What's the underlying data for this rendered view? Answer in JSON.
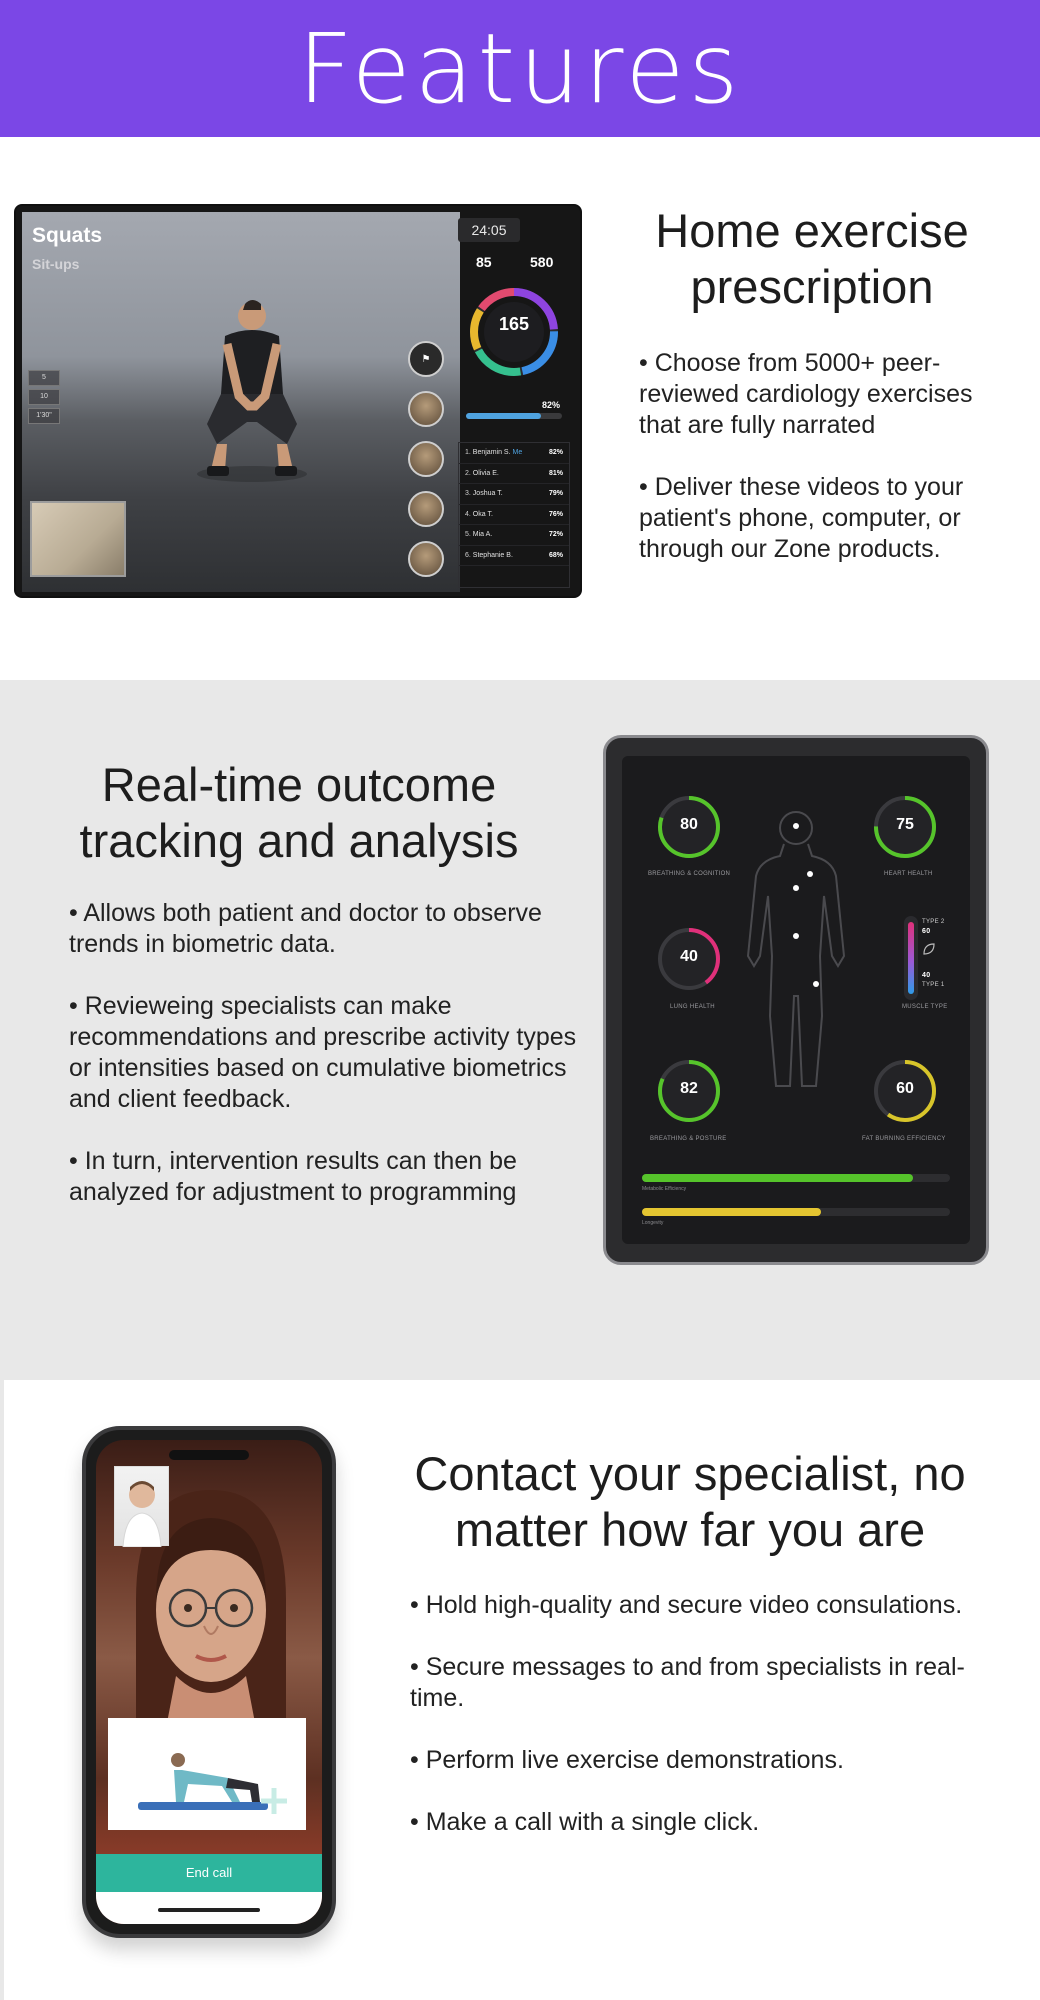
{
  "header": {
    "title": "Features"
  },
  "section1": {
    "title": "Home exercise prescription",
    "bullets": [
      "• Choose from 5000+ peer-reviewed cardiology exercises that are fully narrated",
      "• Deliver these videos to your patient's phone, computer, or through our Zone products."
    ],
    "screen": {
      "exercise_current": "Squats",
      "exercise_next": "Sit-ups",
      "timer": "24:05",
      "stat_left": "85",
      "stat_right": "580",
      "ring_value": "165",
      "percent": "82%",
      "progress_fraction": 0.78,
      "steps": [
        "5",
        "10",
        "1'30\""
      ],
      "leaderboard": [
        {
          "rank": "1.",
          "name": "Benjamin S.",
          "me": "Me",
          "pct": "82%"
        },
        {
          "rank": "2.",
          "name": "Olivia E.",
          "pct": "81%"
        },
        {
          "rank": "3.",
          "name": "Joshua T.",
          "pct": "79%"
        },
        {
          "rank": "4.",
          "name": "Oka T.",
          "pct": "76%"
        },
        {
          "rank": "5.",
          "name": "Mia A.",
          "pct": "72%"
        },
        {
          "rank": "6.",
          "name": "Stephanie B.",
          "pct": "68%"
        }
      ]
    }
  },
  "section2": {
    "title": "Real-time outcome tracking and analysis",
    "bullets": [
      "• Allows both patient and doctor to observe trends in biometric data.",
      "• Revieweing specialists can make recommendations and prescribe activity types or intensities based on cumulative biometrics and client feedback.",
      "• In turn, intervention results can then be analyzed for adjustment to programming"
    ],
    "tablet": {
      "gauges": [
        {
          "value": "80",
          "label": "BREATHING & COGNITION",
          "color": "#56c42b"
        },
        {
          "value": "75",
          "label": "HEART HEALTH",
          "color": "#56c42b"
        },
        {
          "value": "40",
          "label": "LUNG HEALTH",
          "color": "#e0307a"
        },
        {
          "value": "82",
          "label": "BREATHING & POSTURE",
          "color": "#56c42b"
        },
        {
          "value": "60",
          "label": "FAT BURNING EFFICIENCY",
          "color": "#d8c52a"
        }
      ],
      "muscle": {
        "label": "MUSCLE TYPE",
        "type2": "TYPE 2",
        "type2_pct": "60",
        "type1": "TYPE 1",
        "type1_pct": "40"
      },
      "bars": [
        {
          "label": "Metabolic Efficiency",
          "fraction": 0.88,
          "color": "#56c42b"
        },
        {
          "label": "Longevity",
          "fraction": 0.58,
          "color": "#e4c531"
        }
      ]
    }
  },
  "section3": {
    "title": "Contact your specialist, no matter how far you are",
    "bullets": [
      "• Hold high-quality and secure video consulations.",
      "• Secure messages to and from specialists in real-time.",
      "• Perform live exercise demonstrations.",
      "• Make a call with a single click."
    ],
    "phone": {
      "end_call": "End call"
    }
  },
  "colors": {
    "brand": "#7b47e6",
    "alt_bg": "#e8e8e8",
    "end_call": "#2db59d"
  }
}
